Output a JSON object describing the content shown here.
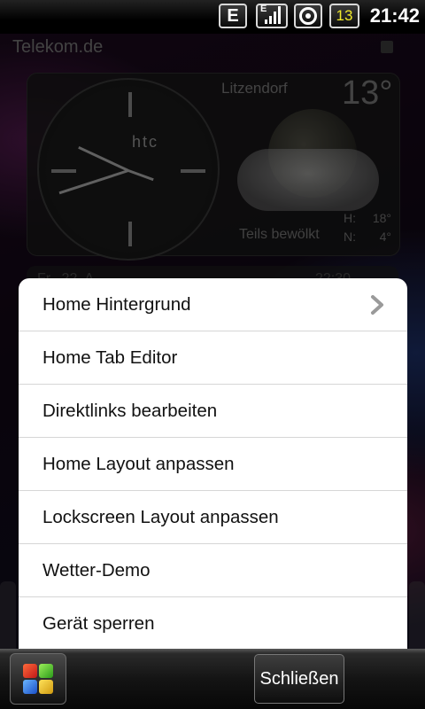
{
  "status_bar": {
    "network_label": "E",
    "signal_network_label": "E",
    "notification_count": "13",
    "time": "21:42"
  },
  "home": {
    "carrier": "Telekom.de",
    "clock_brand": "htc",
    "weather": {
      "location": "Litzendorf",
      "temperature": "13°",
      "condition": "Teils bewölkt",
      "high_label": "H:",
      "high_value": "18°",
      "low_label": "N:",
      "low_value": "4°"
    },
    "partial_row_left": "Fr., 22. A",
    "partial_row_right": "22:30"
  },
  "menu": {
    "items": [
      {
        "label": "Home Hintergrund",
        "has_submenu": true
      },
      {
        "label": "Home Tab Editor"
      },
      {
        "label": "Direktlinks bearbeiten"
      },
      {
        "label": "Home Layout anpassen"
      },
      {
        "label": "Lockscreen Layout anpassen"
      },
      {
        "label": "Wetter-Demo"
      },
      {
        "label": "Gerät sperren"
      }
    ]
  },
  "bottom_bar": {
    "apps_icon": "all-apps-icon",
    "close_label": "Schließen"
  },
  "colors": {
    "menu_bg": "#ffffff",
    "notification_count_color": "#f1ea2b",
    "status_bar_bg": "#000000"
  }
}
